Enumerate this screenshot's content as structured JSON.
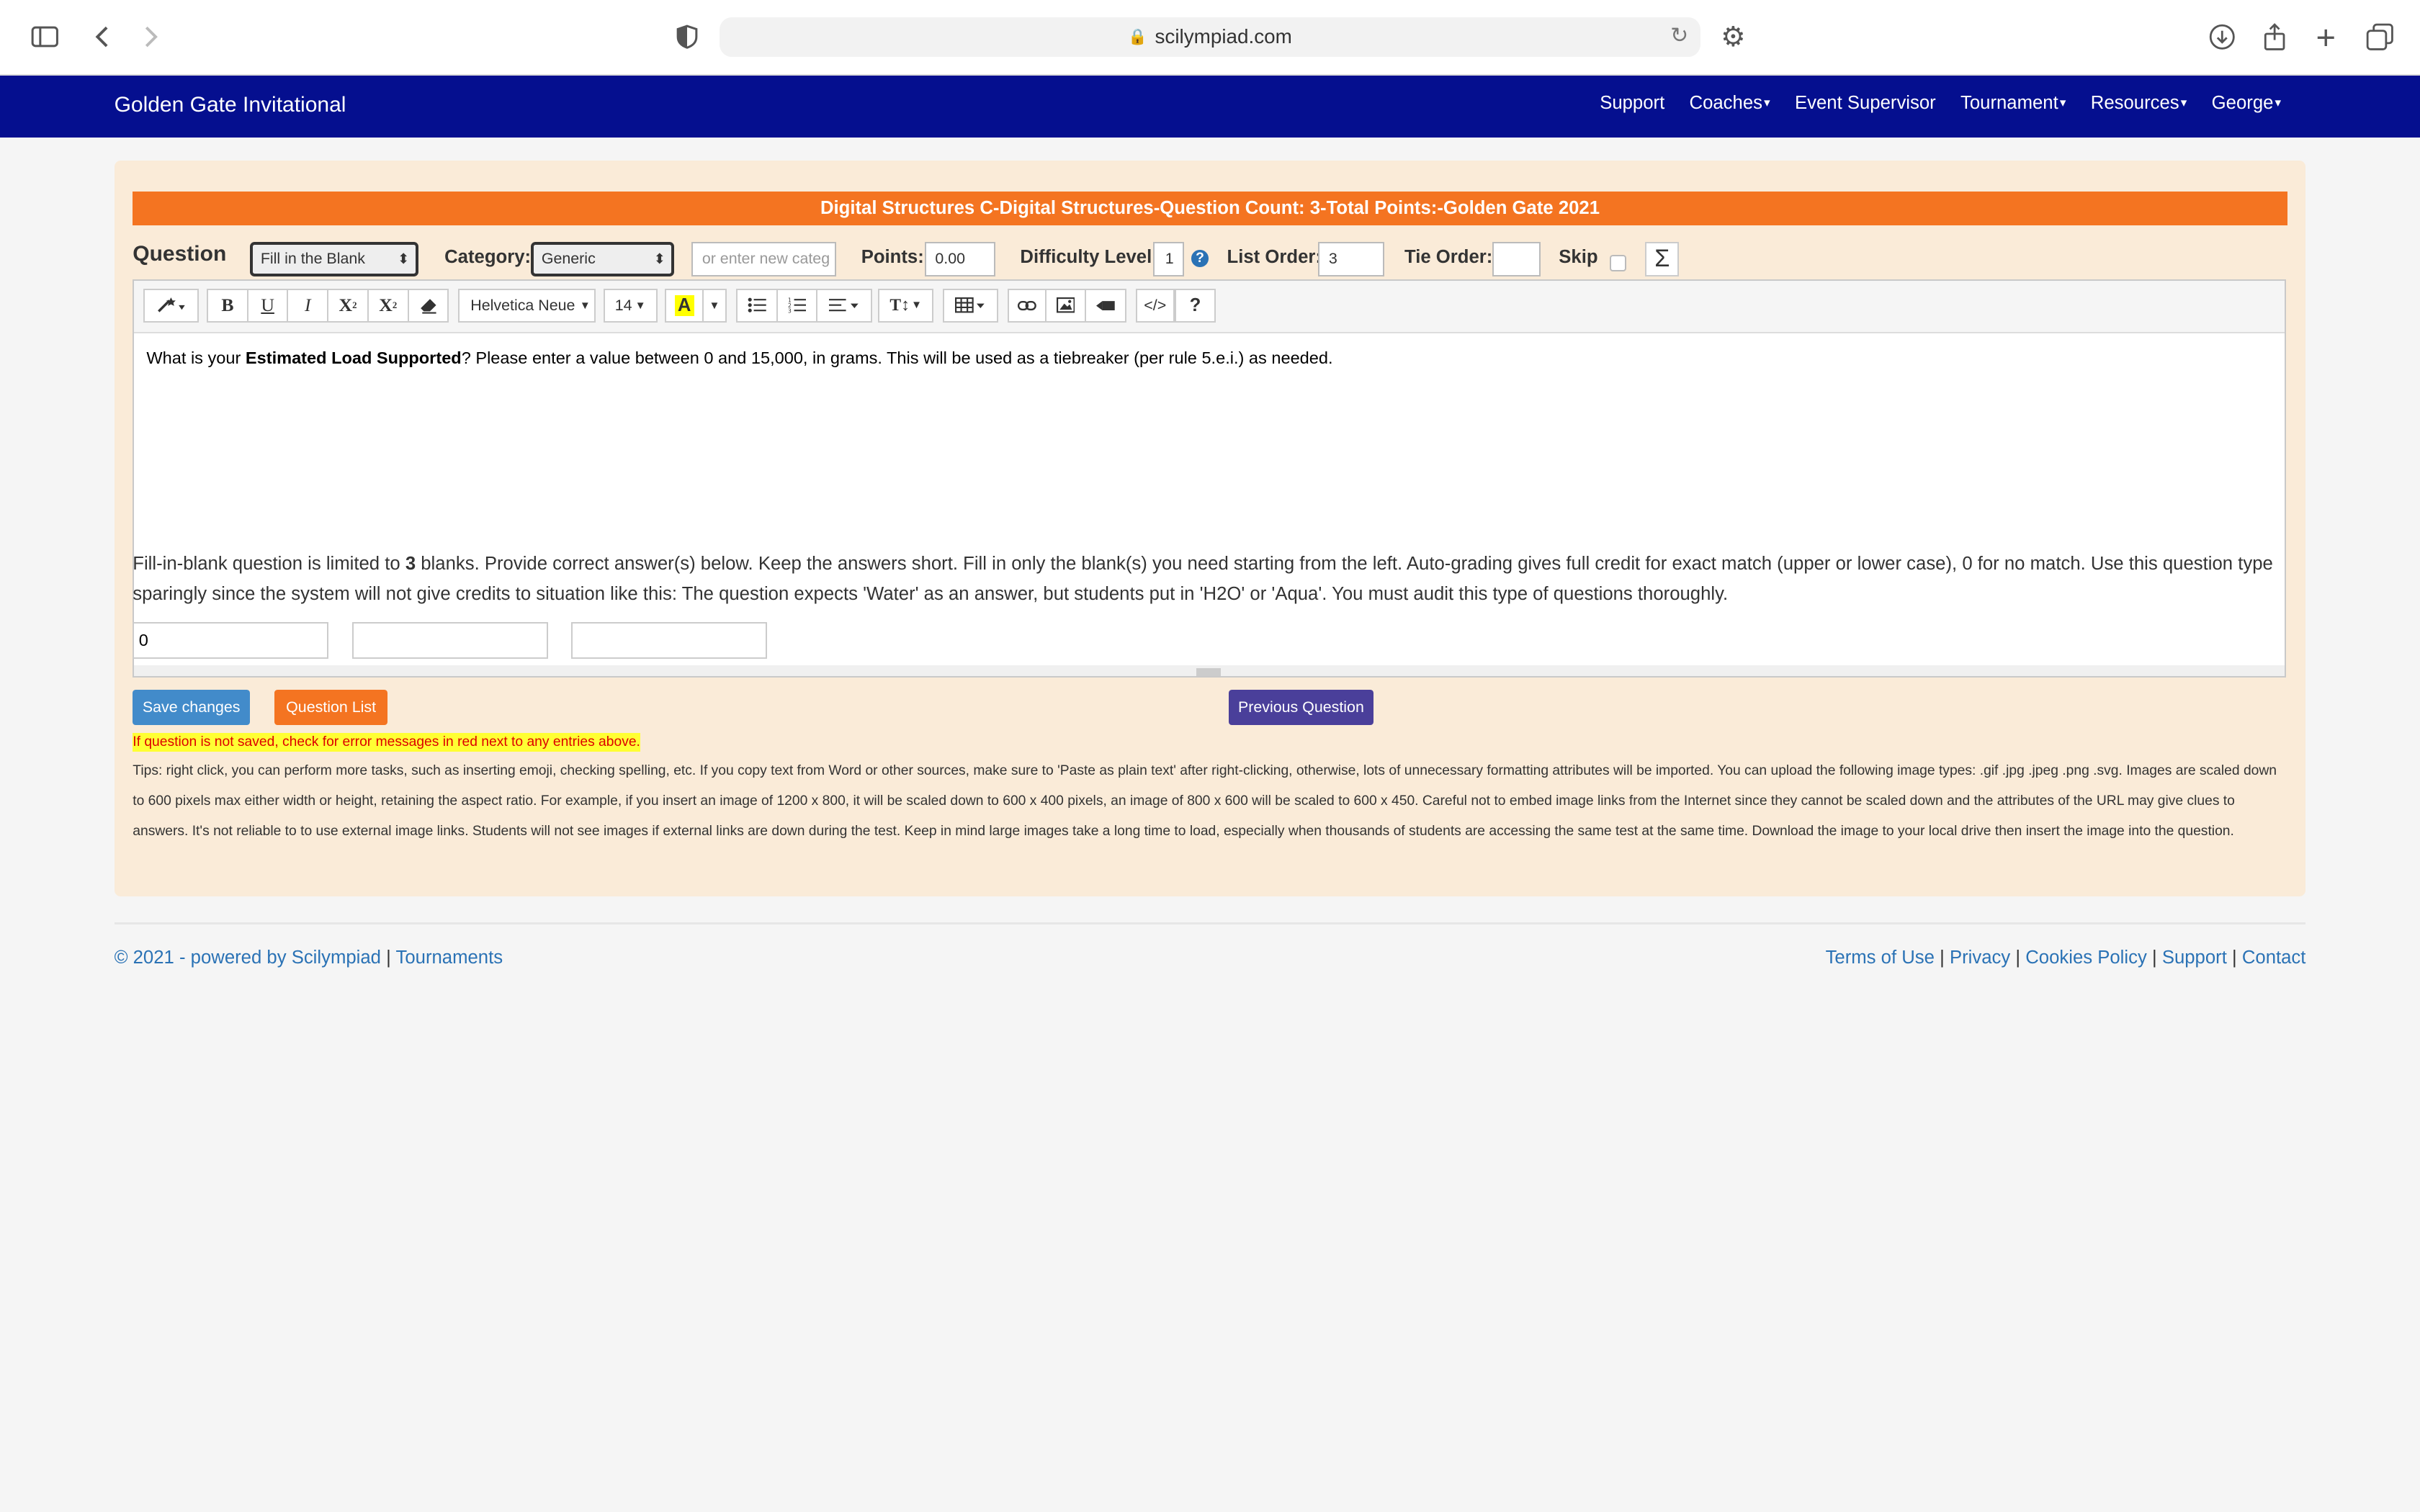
{
  "browser": {
    "url": "scilympiad.com"
  },
  "nav": {
    "brand": "Golden Gate Invitational",
    "links": [
      "Support",
      "Coaches",
      "Event Supervisor",
      "Tournament",
      "Resources",
      "George"
    ]
  },
  "header": {
    "event": "Digital Structures C",
    "subject": "Digital Structures",
    "question_count": "Question Count: 3",
    "total_points": "Total Points:",
    "tournament": "Golden Gate 2021",
    "separator": "-"
  },
  "form": {
    "question_label": "Question",
    "question_type": "Fill in the Blank",
    "category_label": "Category:",
    "category_value": "Generic",
    "new_category_placeholder": "or enter new categ",
    "points_label": "Points:",
    "points_value": "0.00",
    "difficulty_label": "Difficulty Level:",
    "difficulty_value": "1",
    "list_order_label": "List Order:",
    "list_order_value": "3",
    "tie_order_label": "Tie Order:",
    "tie_order_value": "",
    "skip_label": "Skip",
    "sigma": "Σ"
  },
  "toolbar": {
    "bold": "B",
    "underline": "U",
    "italic": "I",
    "superscript": "X",
    "subscript": "X",
    "font_name": "Helvetica Neue",
    "font_size": "14",
    "highlight": "A",
    "code": "</>",
    "help": "?"
  },
  "editor": {
    "before": "What is your ",
    "bold": "Estimated Load Supported",
    "after": "? Please enter a value between 0 and 15,000, in grams. This will be used as a tiebreaker (per rule 5.e.i.) as needed."
  },
  "instructions": {
    "pre": "Fill-in-blank question is limited to ",
    "num": "3",
    "post": " blanks. Provide correct answer(s) below. Keep the answers short. Fill in only the blank(s) you need starting from the left. Auto-grading gives full credit for exact match (upper or lower case), 0 for no match. Use this question type sparingly since the system will not give credits to situation like this: The question expects 'Water' as an answer, but students put in 'H2O' or 'Aqua'. You must audit this type of questions thoroughly."
  },
  "blanks": [
    "0",
    "",
    ""
  ],
  "buttons": {
    "save": "Save changes",
    "list": "Question List",
    "previous": "Previous Question"
  },
  "warning": "If question is not saved, check for error messages in red next to any entries above.",
  "tips": "Tips: right click, you can perform more tasks, such as inserting emoji, checking spelling, etc. If you copy text from Word or other sources, make sure to 'Paste as plain text' after right-clicking, otherwise, lots of unnecessary formatting attributes will be imported. You can upload the following image types: .gif .jpg .jpeg .png .svg. Images are scaled down to 600 pixels max either width or height, retaining the aspect ratio. For example, if you insert an image of 1200 x 800, it will be scaled down to 600 x 400 pixels, an image of 800 x 600 will be scaled to 600 x 450. Careful not to embed image links from the Internet since they cannot be scaled down and the attributes of the URL may give clues to answers. It's not reliable to to use external image links. Students will not see images if external links are down during the test. Keep in mind large images take a long time to load, especially when thousands of students are accessing the same test at the same time. Download the image to your local drive then insert the image into the question.",
  "footer": {
    "copyright": "© 2021 - powered by Scilympiad",
    "tournaments": "Tournaments",
    "links": [
      "Terms of Use",
      "Privacy",
      "Cookies Policy",
      "Support",
      "Contact"
    ],
    "separator": "|"
  },
  "colors": {
    "navbar": "#050f8f",
    "header": "#f47421",
    "panel": "#faebd8",
    "save": "#428bca",
    "list": "#f47421",
    "previous": "#4a3f9a"
  }
}
